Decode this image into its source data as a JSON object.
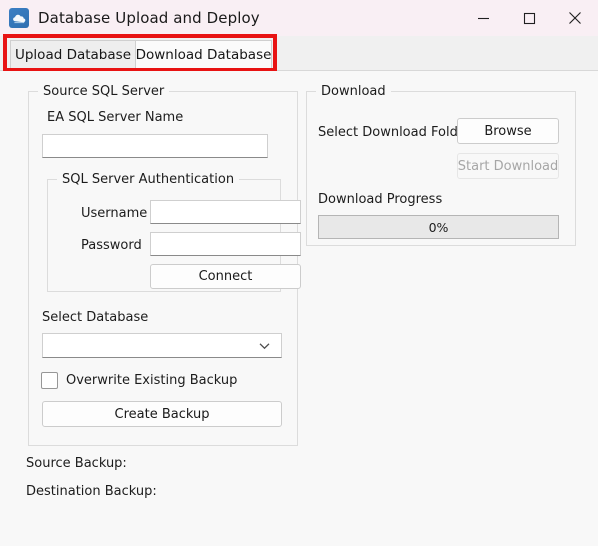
{
  "window": {
    "title": "Database Upload and Deploy",
    "icon": "cloud-database-icon",
    "minimize_label": "—",
    "maximize_label": "□",
    "close_label": "✕",
    "titlebar_color": "#f9eff4",
    "body_color": "#f8f8f8"
  },
  "tabs": {
    "items": [
      {
        "label": "Upload Database",
        "selected": false
      },
      {
        "label": "Download Database",
        "selected": true
      }
    ],
    "highlight_color": "#e81313"
  },
  "source_group": {
    "title": "Source SQL Server",
    "server_name_label": "EA SQL Server Name",
    "server_name_value": "",
    "server_name_placeholder": "",
    "auth_group": {
      "title": "SQL Server Authentication",
      "username_label": "Username",
      "username_value": "",
      "password_label": "Password",
      "password_value": "",
      "connect_label": "Connect"
    },
    "select_database_label": "Select Database",
    "select_database_value": "",
    "overwrite_label": "Overwrite Existing Backup",
    "overwrite_checked": false,
    "create_backup_label": "Create Backup"
  },
  "download_group": {
    "title": "Download",
    "folder_label": "Select Download Folder",
    "browse_label": "Browse",
    "start_download_label": "Start Download",
    "start_download_enabled": false,
    "progress_label": "Download Progress",
    "progress_value": "0%",
    "progress_percent": 0
  },
  "status": {
    "source_backup_label": "Source Backup:",
    "source_backup_value": "",
    "destination_backup_label": "Destination Backup:",
    "destination_backup_value": ""
  }
}
